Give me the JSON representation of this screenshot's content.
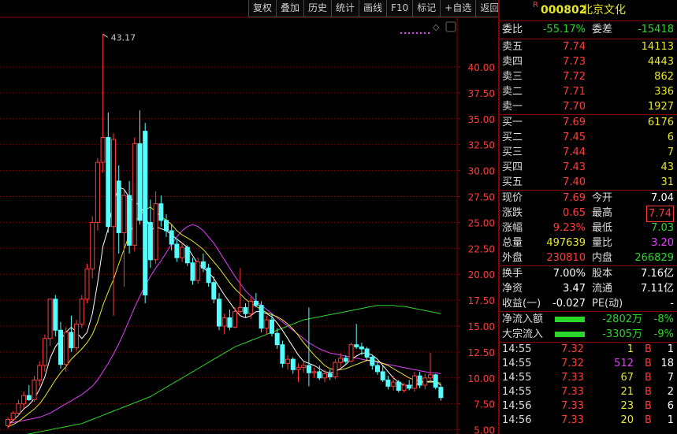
{
  "toolbar": [
    "复权",
    "叠加",
    "历史",
    "统计",
    "画线",
    "F10",
    "标记",
    "+自选",
    "返回"
  ],
  "stock": {
    "badge": "R",
    "code": "000802",
    "name": "北京文化"
  },
  "weibi": {
    "label": "委比",
    "value": "-55.17%",
    "label2": "委差",
    "value2": "-15418"
  },
  "asks": [
    {
      "label": "卖五",
      "price": "7.74",
      "vol": "14113"
    },
    {
      "label": "卖四",
      "price": "7.73",
      "vol": "4443"
    },
    {
      "label": "卖三",
      "price": "7.72",
      "vol": "862"
    },
    {
      "label": "卖二",
      "price": "7.71",
      "vol": "336"
    },
    {
      "label": "卖一",
      "price": "7.70",
      "vol": "1927"
    }
  ],
  "bids": [
    {
      "label": "买一",
      "price": "7.69",
      "vol": "6176"
    },
    {
      "label": "买二",
      "price": "7.45",
      "vol": "6"
    },
    {
      "label": "买三",
      "price": "7.44",
      "vol": "7"
    },
    {
      "label": "买四",
      "price": "7.43",
      "vol": "43"
    },
    {
      "label": "买五",
      "price": "7.40",
      "vol": "31"
    }
  ],
  "quote": [
    {
      "l1": "现价",
      "v1": "7.69",
      "c1": "red",
      "l2": "今开",
      "v2": "7.04",
      "c2": "white"
    },
    {
      "l1": "涨跌",
      "v1": "0.65",
      "c1": "red",
      "l2": "最高",
      "v2": "7.74",
      "c2": "red"
    },
    {
      "l1": "涨幅",
      "v1": "9.23%",
      "c1": "red",
      "l2": "最低",
      "v2": "7.03",
      "c2": "green"
    },
    {
      "l1": "总量",
      "v1": "497639",
      "c1": "yellow",
      "l2": "量比",
      "v2": "3.20",
      "c2": "magenta"
    },
    {
      "l1": "外盘",
      "v1": "230810",
      "c1": "red",
      "l2": "内盘",
      "v2": "266829",
      "c2": "green"
    }
  ],
  "stats": [
    {
      "l1": "换手",
      "v1": "7.00%",
      "l2": "股本",
      "v2": "7.16亿"
    },
    {
      "l1": "净资",
      "v1": "3.47",
      "l2": "流通",
      "v2": "7.11亿"
    },
    {
      "l1": "收益(一)",
      "v1": "-0.027",
      "l2": "PE(动)",
      "v2": "-"
    }
  ],
  "flows": [
    {
      "label": "净流入额",
      "value": "-2802万",
      "pct": "-8%"
    },
    {
      "label": "大宗流入",
      "value": "-3305万",
      "pct": "-9%"
    }
  ],
  "ticks": [
    {
      "time": "14:55",
      "price": "7.32",
      "vol": "1",
      "bs": "B",
      "n": "1",
      "volc": "yellow"
    },
    {
      "time": "14:55",
      "price": "7.32",
      "vol": "512",
      "bs": "B",
      "n": "18",
      "volc": "magenta"
    },
    {
      "time": "14:55",
      "price": "7.33",
      "vol": "67",
      "bs": "B",
      "n": "7",
      "volc": "yellow"
    },
    {
      "time": "14:55",
      "price": "7.33",
      "vol": "21",
      "bs": "B",
      "n": "2",
      "volc": "yellow"
    },
    {
      "time": "14:56",
      "price": "7.33",
      "vol": "23",
      "bs": "B",
      "n": "6",
      "volc": "yellow"
    },
    {
      "time": "14:56",
      "price": "7.33",
      "vol": "20",
      "bs": "B",
      "n": "1",
      "volc": "yellow"
    }
  ],
  "chart_data": {
    "type": "candlestick",
    "y_ticks": [
      "40.00",
      "37.50",
      "35.00",
      "32.50",
      "30.00",
      "27.50",
      "25.00",
      "22.50",
      "20.00",
      "17.50",
      "15.00",
      "12.50",
      "10.00",
      "7.50",
      "5.00"
    ],
    "ylim": [
      5.0,
      42.5
    ],
    "high_annotation": "43.17",
    "candles": [
      {
        "o": 5.4,
        "h": 6.2,
        "l": 5.1,
        "c": 6.0
      },
      {
        "o": 6.0,
        "h": 6.8,
        "l": 5.8,
        "c": 6.6
      },
      {
        "o": 6.6,
        "h": 7.9,
        "l": 6.3,
        "c": 7.5
      },
      {
        "o": 7.5,
        "h": 8.7,
        "l": 7.0,
        "c": 8.3
      },
      {
        "o": 8.3,
        "h": 9.3,
        "l": 7.8,
        "c": 7.9
      },
      {
        "o": 7.9,
        "h": 10.2,
        "l": 7.7,
        "c": 9.8
      },
      {
        "o": 9.8,
        "h": 11.6,
        "l": 9.2,
        "c": 11.2
      },
      {
        "o": 11.2,
        "h": 14.2,
        "l": 10.6,
        "c": 13.8
      },
      {
        "o": 13.8,
        "h": 16.8,
        "l": 13.1,
        "c": 17.6
      },
      {
        "o": 17.6,
        "h": 18.0,
        "l": 14.0,
        "c": 14.6
      },
      {
        "o": 14.6,
        "h": 15.4,
        "l": 10.9,
        "c": 11.3
      },
      {
        "o": 11.3,
        "h": 14.9,
        "l": 10.6,
        "c": 14.4
      },
      {
        "o": 14.4,
        "h": 16.0,
        "l": 12.5,
        "c": 12.9
      },
      {
        "o": 12.9,
        "h": 15.6,
        "l": 12.6,
        "c": 15.2
      },
      {
        "o": 15.2,
        "h": 18.0,
        "l": 14.8,
        "c": 17.6
      },
      {
        "o": 17.6,
        "h": 21.0,
        "l": 17.2,
        "c": 20.5
      },
      {
        "o": 20.5,
        "h": 25.6,
        "l": 19.6,
        "c": 25.0
      },
      {
        "o": 25.0,
        "h": 31.2,
        "l": 24.2,
        "c": 30.8
      },
      {
        "o": 30.8,
        "h": 43.17,
        "l": 29.8,
        "c": 33.2
      },
      {
        "o": 33.2,
        "h": 35.6,
        "l": 24.0,
        "c": 24.6
      },
      {
        "o": 24.6,
        "h": 33.6,
        "l": 16.0,
        "c": 33.0
      },
      {
        "o": 29.0,
        "h": 30.5,
        "l": 22.0,
        "c": 24.0
      },
      {
        "o": 24.0,
        "h": 28.2,
        "l": 18.8,
        "c": 27.6
      },
      {
        "o": 27.6,
        "h": 29.0,
        "l": 22.0,
        "c": 22.8
      },
      {
        "o": 22.8,
        "h": 33.2,
        "l": 22.2,
        "c": 32.6
      },
      {
        "o": 32.6,
        "h": 35.8,
        "l": 24.8,
        "c": 25.2
      },
      {
        "o": 33.8,
        "h": 34.6,
        "l": 17.2,
        "c": 18.0
      },
      {
        "o": 25.0,
        "h": 27.2,
        "l": 20.6,
        "c": 21.4
      },
      {
        "o": 21.4,
        "h": 28.0,
        "l": 21.0,
        "c": 26.8
      },
      {
        "o": 26.8,
        "h": 27.6,
        "l": 24.6,
        "c": 25.2
      },
      {
        "o": 25.2,
        "h": 25.8,
        "l": 23.6,
        "c": 24.2
      },
      {
        "o": 24.2,
        "h": 24.8,
        "l": 22.3,
        "c": 22.9
      },
      {
        "o": 22.9,
        "h": 23.4,
        "l": 21.2,
        "c": 21.6
      },
      {
        "o": 21.6,
        "h": 23.0,
        "l": 21.2,
        "c": 22.6
      },
      {
        "o": 22.6,
        "h": 22.8,
        "l": 20.8,
        "c": 21.1
      },
      {
        "o": 21.1,
        "h": 21.6,
        "l": 19.0,
        "c": 19.4
      },
      {
        "o": 19.4,
        "h": 21.6,
        "l": 19.1,
        "c": 21.2
      },
      {
        "o": 21.2,
        "h": 22.0,
        "l": 20.2,
        "c": 20.6
      },
      {
        "o": 20.6,
        "h": 21.0,
        "l": 18.8,
        "c": 19.2
      },
      {
        "o": 19.2,
        "h": 19.8,
        "l": 17.2,
        "c": 17.6
      },
      {
        "o": 17.6,
        "h": 18.2,
        "l": 14.6,
        "c": 15.0
      },
      {
        "o": 15.0,
        "h": 16.2,
        "l": 14.2,
        "c": 15.8
      },
      {
        "o": 15.8,
        "h": 16.6,
        "l": 14.6,
        "c": 14.9
      },
      {
        "o": 14.9,
        "h": 16.8,
        "l": 14.8,
        "c": 16.4
      },
      {
        "o": 16.4,
        "h": 20.6,
        "l": 16.2,
        "c": 16.8
      },
      {
        "o": 16.8,
        "h": 17.2,
        "l": 15.8,
        "c": 16.2
      },
      {
        "o": 16.2,
        "h": 17.8,
        "l": 15.7,
        "c": 17.4
      },
      {
        "o": 17.4,
        "h": 18.2,
        "l": 16.8,
        "c": 17.0
      },
      {
        "o": 17.0,
        "h": 17.4,
        "l": 14.4,
        "c": 14.8
      },
      {
        "o": 14.8,
        "h": 16.0,
        "l": 14.2,
        "c": 15.6
      },
      {
        "o": 15.6,
        "h": 16.2,
        "l": 14.0,
        "c": 14.3
      },
      {
        "o": 14.3,
        "h": 14.8,
        "l": 12.8,
        "c": 13.2
      },
      {
        "o": 13.2,
        "h": 13.6,
        "l": 11.0,
        "c": 11.4
      },
      {
        "o": 11.4,
        "h": 12.2,
        "l": 10.8,
        "c": 11.8
      },
      {
        "o": 11.8,
        "h": 12.0,
        "l": 10.4,
        "c": 10.8
      },
      {
        "o": 10.8,
        "h": 11.4,
        "l": 9.6,
        "c": 11.0
      },
      {
        "o": 11.0,
        "h": 11.6,
        "l": 10.5,
        "c": 11.2
      },
      {
        "o": 11.2,
        "h": 16.8,
        "l": 9.2,
        "c": 10.5
      },
      {
        "o": 10.5,
        "h": 11.0,
        "l": 10.0,
        "c": 10.6
      },
      {
        "o": 10.6,
        "h": 11.2,
        "l": 9.8,
        "c": 10.0
      },
      {
        "o": 10.0,
        "h": 10.8,
        "l": 9.6,
        "c": 10.4
      },
      {
        "o": 10.4,
        "h": 10.8,
        "l": 9.8,
        "c": 10.1
      },
      {
        "o": 10.1,
        "h": 11.8,
        "l": 9.9,
        "c": 11.5
      },
      {
        "o": 11.5,
        "h": 12.4,
        "l": 11.0,
        "c": 11.9
      },
      {
        "o": 11.9,
        "h": 12.2,
        "l": 11.4,
        "c": 11.6
      },
      {
        "o": 11.6,
        "h": 13.4,
        "l": 11.5,
        "c": 13.2
      },
      {
        "o": 13.2,
        "h": 15.2,
        "l": 12.8,
        "c": 13.0
      },
      {
        "o": 13.0,
        "h": 13.4,
        "l": 12.2,
        "c": 12.8
      },
      {
        "o": 12.8,
        "h": 13.0,
        "l": 11.6,
        "c": 12.0
      },
      {
        "o": 12.0,
        "h": 12.2,
        "l": 10.8,
        "c": 11.2
      },
      {
        "o": 11.2,
        "h": 11.6,
        "l": 10.3,
        "c": 10.6
      },
      {
        "o": 10.6,
        "h": 11.2,
        "l": 9.6,
        "c": 9.8
      },
      {
        "o": 9.8,
        "h": 10.2,
        "l": 8.9,
        "c": 9.2
      },
      {
        "o": 9.2,
        "h": 10.2,
        "l": 8.8,
        "c": 9.6
      },
      {
        "o": 9.6,
        "h": 9.8,
        "l": 8.6,
        "c": 8.8
      },
      {
        "o": 8.8,
        "h": 9.5,
        "l": 8.6,
        "c": 9.3
      },
      {
        "o": 9.3,
        "h": 9.8,
        "l": 8.8,
        "c": 9.0
      },
      {
        "o": 9.0,
        "h": 10.6,
        "l": 8.7,
        "c": 10.2
      },
      {
        "o": 10.2,
        "h": 10.6,
        "l": 9.0,
        "c": 9.3
      },
      {
        "o": 9.3,
        "h": 10.4,
        "l": 8.9,
        "c": 10.0
      },
      {
        "o": 10.0,
        "h": 12.4,
        "l": 9.8,
        "c": 10.3
      },
      {
        "o": 10.3,
        "h": 10.4,
        "l": 8.9,
        "c": 9.1
      },
      {
        "o": 9.1,
        "h": 9.4,
        "l": 7.8,
        "c": 8.1
      }
    ],
    "ma5": [
      5.5,
      5.9,
      6.4,
      7.0,
      7.4,
      8.0,
      8.9,
      10.1,
      11.9,
      13.0,
      13.7,
      14.4,
      14.9,
      14.4,
      13.8,
      14.4,
      16.2,
      19.2,
      22.7,
      24.4,
      27.0,
      28.4,
      28.2,
      27.4,
      27.0,
      26.6,
      25.8,
      24.2,
      24.6,
      24.4,
      24.2,
      23.8,
      23.4,
      23.0,
      22.6,
      21.8,
      21.0,
      20.6,
      20.2,
      19.6,
      18.8,
      18.0,
      17.3,
      16.6,
      16.0,
      15.8,
      16.0,
      16.4,
      16.4,
      16.2,
      15.9,
      15.3,
      14.6,
      13.8,
      13.0,
      12.2,
      11.6,
      11.4,
      11.2,
      10.9,
      10.6,
      10.5,
      10.6,
      10.9,
      11.3,
      11.8,
      12.1,
      12.4,
      12.4,
      12.2,
      11.8,
      11.2,
      10.6,
      10.0,
      9.6,
      9.3,
      9.3,
      9.3,
      9.5,
      9.6,
      9.7,
      9.6,
      9.3
    ],
    "ma10": [
      5.3,
      5.5,
      5.8,
      6.2,
      6.6,
      7.0,
      7.5,
      8.2,
      9.0,
      9.8,
      10.5,
      11.1,
      11.8,
      12.3,
      12.8,
      13.4,
      14.2,
      15.4,
      17.0,
      18.3,
      19.5,
      21.0,
      22.4,
      23.8,
      25.0,
      25.7,
      26.2,
      26.5,
      26.0,
      25.6,
      25.2,
      24.8,
      24.2,
      23.8,
      23.5,
      23.2,
      22.8,
      22.4,
      21.8,
      21.2,
      20.6,
      19.9,
      19.2,
      18.6,
      18.1,
      17.6,
      17.2,
      16.9,
      16.6,
      16.3,
      16.1,
      15.9,
      15.6,
      15.2,
      14.7,
      14.1,
      13.4,
      12.8,
      12.2,
      11.7,
      11.2,
      10.9,
      10.8,
      10.8,
      10.9,
      11.1,
      11.3,
      11.5,
      11.7,
      11.7,
      11.6,
      11.4,
      11.2,
      10.9,
      10.6,
      10.3,
      10.0,
      9.8,
      9.7,
      9.6,
      9.6,
      9.6,
      9.5
    ],
    "ma30": [
      5.6,
      5.7,
      5.8,
      5.9,
      6.0,
      6.1,
      6.2,
      6.4,
      6.6,
      6.9,
      7.2,
      7.5,
      7.8,
      8.1,
      8.4,
      8.8,
      9.2,
      9.8,
      10.6,
      11.4,
      12.3,
      13.3,
      14.4,
      15.6,
      16.8,
      17.9,
      18.9,
      19.8,
      20.6,
      21.3,
      22.1,
      22.9,
      23.6,
      24.2,
      24.6,
      24.8,
      24.6,
      24.2,
      23.6,
      23.0,
      22.2,
      21.4,
      20.6,
      19.8,
      19.1,
      18.4,
      17.9,
      17.4,
      17.0,
      16.6,
      16.2,
      15.8,
      15.4,
      15.0,
      14.6,
      14.2,
      13.8,
      13.4,
      13.1,
      12.8,
      12.6,
      12.4,
      12.3,
      12.2,
      12.1,
      12.0,
      11.9,
      11.8,
      11.7,
      11.6,
      11.5,
      11.4,
      11.3,
      11.2,
      11.1,
      11.0,
      10.9,
      10.8,
      10.7,
      10.6,
      10.5,
      10.5,
      10.4
    ],
    "ma60": [
      4.2,
      4.3,
      4.4,
      4.5,
      4.6,
      4.7,
      4.8,
      4.9,
      5.0,
      5.1,
      5.2,
      5.3,
      5.4,
      5.5,
      5.6,
      5.8,
      6.0,
      6.2,
      6.4,
      6.6,
      6.8,
      7.0,
      7.2,
      7.4,
      7.6,
      7.8,
      8.0,
      8.2,
      8.5,
      8.8,
      9.1,
      9.4,
      9.7,
      10.0,
      10.3,
      10.6,
      10.9,
      11.2,
      11.5,
      11.8,
      12.1,
      12.4,
      12.7,
      13.0,
      13.2,
      13.4,
      13.6,
      13.8,
      14.0,
      14.2,
      14.4,
      14.6,
      14.8,
      15.0,
      15.2,
      15.4,
      15.6,
      15.7,
      15.8,
      15.9,
      16.0,
      16.1,
      16.2,
      16.3,
      16.4,
      16.5,
      16.6,
      16.7,
      16.8,
      16.9,
      17.0,
      17.0,
      17.0,
      17.0,
      16.9,
      16.9,
      16.8,
      16.7,
      16.6,
      16.5,
      16.4,
      16.3,
      16.2
    ]
  },
  "colors": {
    "up": "#ff3b3b",
    "down": "#54ffff",
    "ma5": "#ffffff",
    "ma10": "#e7e72a",
    "ma30": "#e040fb",
    "ma60": "#2bd62b",
    "grid": "#8b0000"
  }
}
